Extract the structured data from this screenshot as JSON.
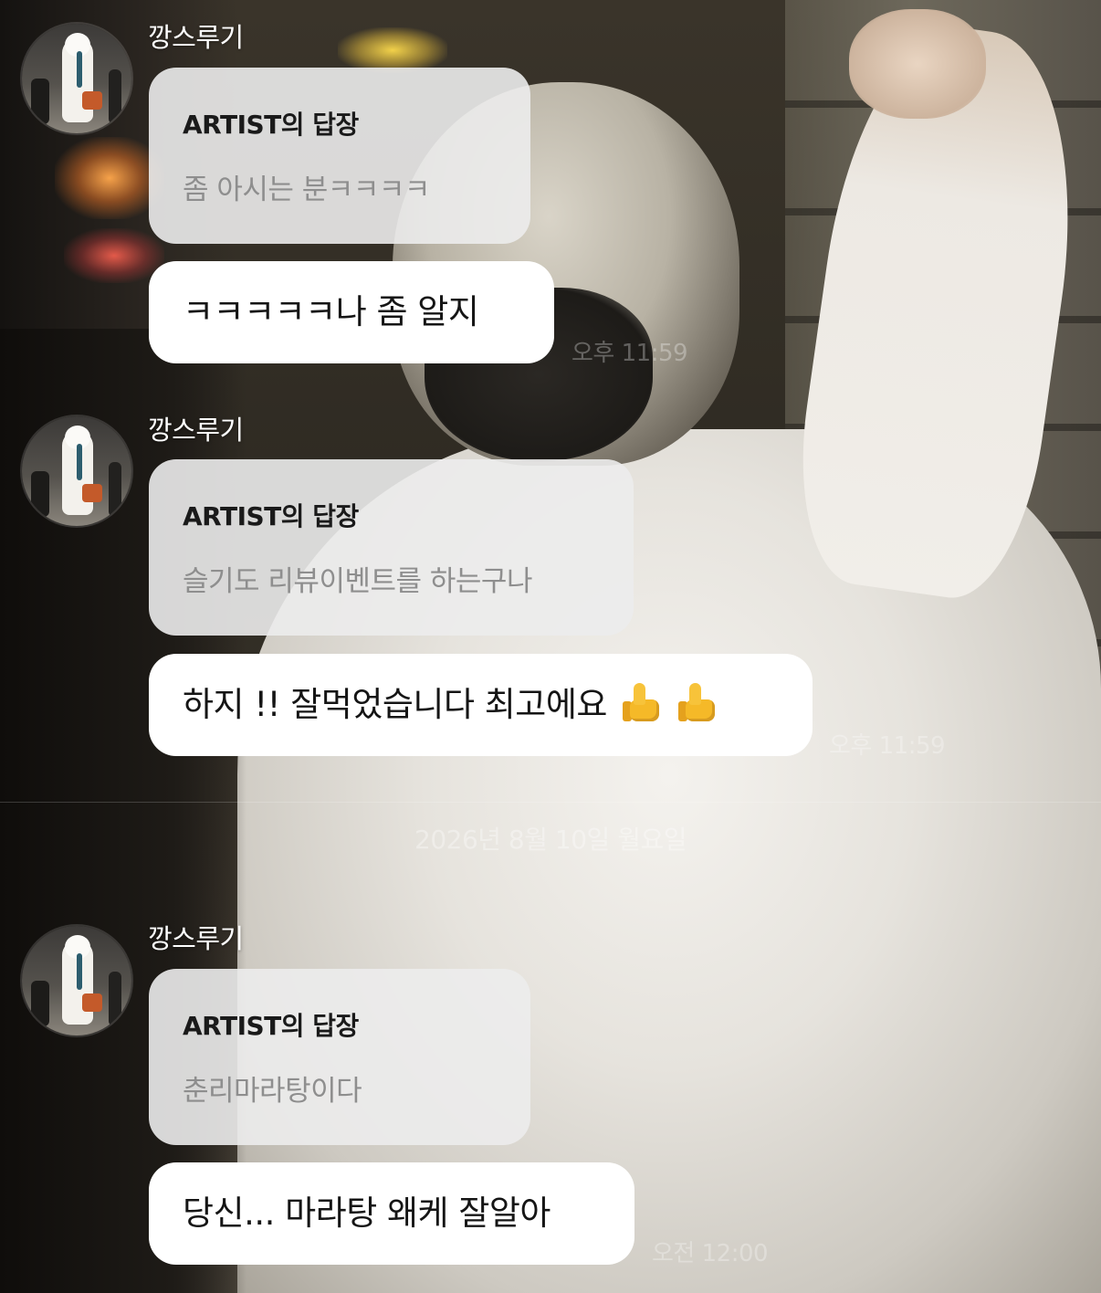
{
  "groups": [
    {
      "sender": "깡스루기",
      "reply_title": "ARTIST의 답장",
      "reply_text": "좀 아시는 분ㅋㅋㅋㅋ",
      "message": "ㅋㅋㅋㅋㅋ나 좀 알지",
      "time": "오후 11:59"
    },
    {
      "sender": "깡스루기",
      "reply_title": "ARTIST의 답장",
      "reply_text": "슬기도 리뷰이벤트를 하는구나",
      "message": "하지 !! 잘먹었습니다 최고에요",
      "message_emoji": [
        "thumbs-up",
        "thumbs-up"
      ],
      "time": "오후 11:59"
    },
    {
      "sender": "깡스루기",
      "reply_title": "ARTIST의 답장",
      "reply_text": "춘리마라탕이다",
      "message": "당신... 마라탕 왜케 잘알아",
      "time": "오전 12:00"
    }
  ],
  "date_separator": "2026년 8월 10일 월요일",
  "colors": {
    "bubble": "#ffffff",
    "reply_bubble": "#ececec",
    "reply_text": "#8e8e8e"
  }
}
